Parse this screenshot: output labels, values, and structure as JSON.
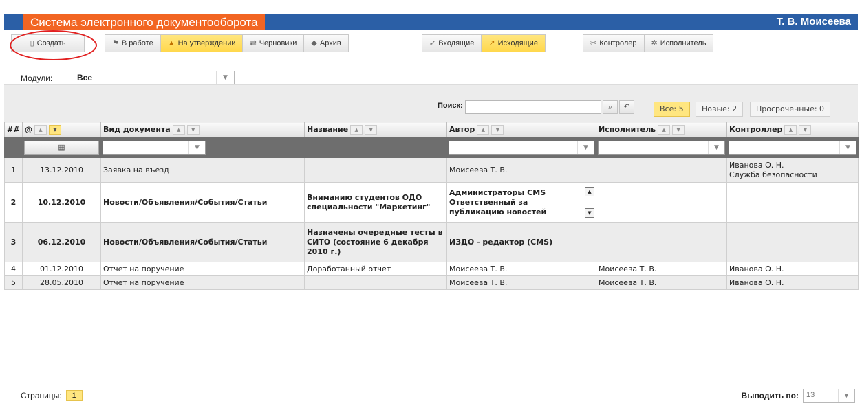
{
  "header": {
    "app_title": "Система электронного документооборота",
    "user_name": "Т. В. Моисеева"
  },
  "toolbar": {
    "create": "Создать",
    "status_buttons": [
      "В работе",
      "На утверждении",
      "Черновики",
      "Архив"
    ],
    "direction_buttons": [
      "Входящие",
      "Исходящие"
    ],
    "role_buttons": [
      "Контролер",
      "Исполнитель"
    ],
    "active_status": "На утверждении",
    "active_direction": "Исходящие"
  },
  "modules": {
    "label": "Модули:",
    "value": "Все"
  },
  "search": {
    "label": "Поиск:",
    "value": ""
  },
  "counters": {
    "all": "Все: 5",
    "new": "Новые: 2",
    "overdue": "Просроченные: 0"
  },
  "table": {
    "columns": [
      "##",
      "@",
      "Вид документа",
      "Название",
      "Автор",
      "Исполнитель",
      "Контроллер"
    ],
    "rows": [
      {
        "num": "1",
        "date": "13.12.2010",
        "type": "Заявка на въезд",
        "name": "",
        "author": "Моисеева Т. В.",
        "executor": "",
        "controller": "Иванова О. Н.\nСлужба безопасности"
      },
      {
        "num": "2",
        "date": "10.12.2010",
        "type": "Новости/Объявления/События/Статьи",
        "name": "Вниманию студентов ОДО специальности \"Маркетинг\"",
        "author": "Администраторы CMS Ответственный за публикацию новостей",
        "executor": "",
        "controller": ""
      },
      {
        "num": "3",
        "date": "06.12.2010",
        "type": "Новости/Объявления/События/Статьи",
        "name": "Назначены очередные тесты в СИТО (состояние 6 декабря 2010 г.)",
        "author": "ИЗДО - редактор (CMS)",
        "executor": "",
        "controller": ""
      },
      {
        "num": "4",
        "date": "01.12.2010",
        "type": "Отчет на поручение",
        "name": "Доработанный отчет",
        "author": "Моисеева Т. В.",
        "executor": "Моисеева Т. В.",
        "controller": "Иванова О. Н."
      },
      {
        "num": "5",
        "date": "28.05.2010",
        "type": "Отчет на поручение",
        "name": "",
        "author": "Моисеева Т. В.",
        "executor": "Моисеева Т. В.",
        "controller": "Иванова О. Н."
      }
    ]
  },
  "pager": {
    "label": "Страницы:",
    "current": "1"
  },
  "per_page": {
    "label": "Выводить по:",
    "value": "13"
  },
  "colors": {
    "header_bg": "#2b5fa6",
    "title_bg": "#f26522",
    "active_bg": "#ffe680",
    "highlight_circle": "#e22020"
  }
}
